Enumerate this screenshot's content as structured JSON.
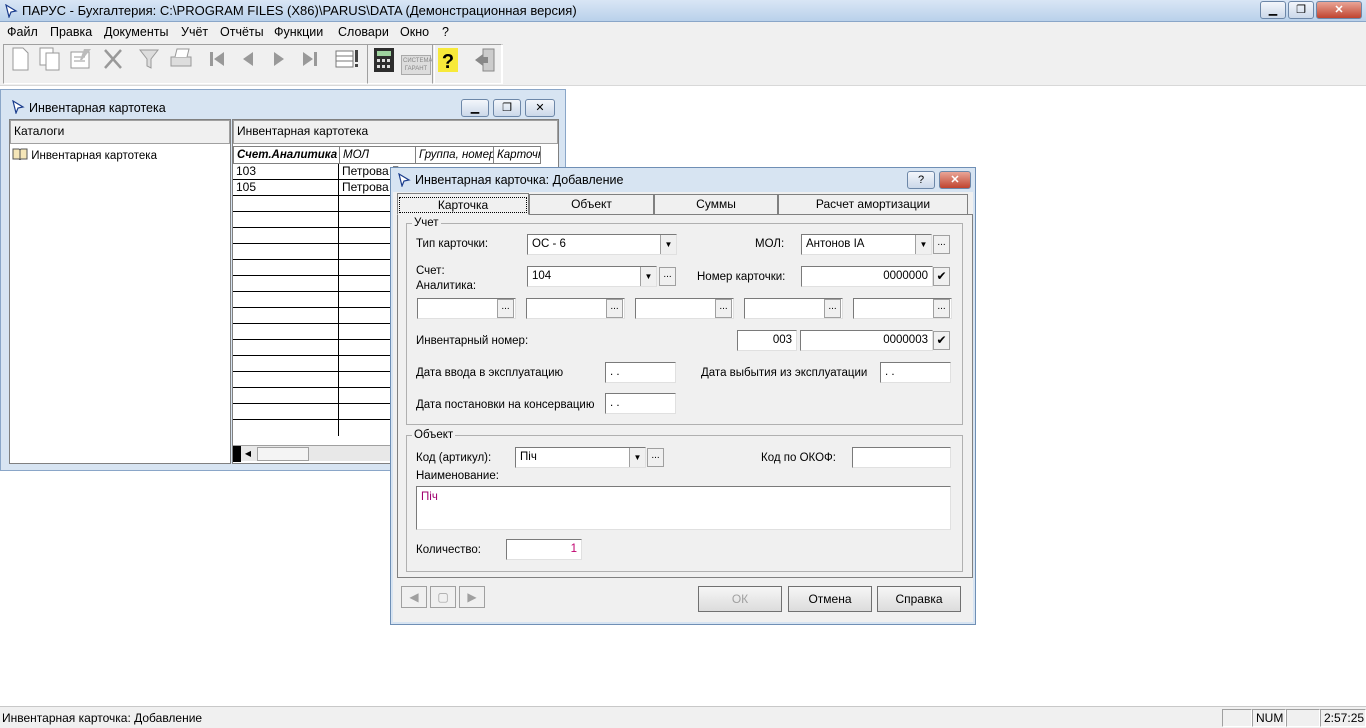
{
  "app": {
    "title": "ПАРУС - Бухгалтерия: C:\\PROGRAM FILES (X86)\\PARUS\\DATA (Демонстрационная версия)",
    "minimize_label": "▁",
    "maximize_label": "❐",
    "close_label": "✕"
  },
  "menu": [
    "Файл",
    "Правка",
    "Документы",
    "Учёт",
    "Отчёты",
    "Функции",
    "Словари",
    "Окно",
    "?"
  ],
  "toolbar": {
    "icons": [
      "new-doc-icon",
      "copy-doc-icon",
      "edit-doc-icon",
      "delete-icon",
      "filter-icon",
      "print-icon",
      "first-record-icon",
      "prev-record-icon",
      "next-record-icon",
      "last-record-icon",
      "list-action-icon",
      "calculator-icon",
      "garant-system-icon",
      "help-icon",
      "exit-icon"
    ],
    "garant_label": "СИСТЕМА ГАРАНТ"
  },
  "child_window": {
    "title": "Инвентарная картотека",
    "catalog_header": "Каталоги",
    "catalog_item": "Инвентарная картотека",
    "list_header": "Инвентарная картотека",
    "columns": [
      "Счет.Аналитика",
      "МОЛ",
      "Группа, номер",
      "Карточка"
    ],
    "rows": [
      {
        "account": "103",
        "mol": "Петрова Г"
      },
      {
        "account": "105",
        "mol": "Петрова Г"
      }
    ]
  },
  "dialog": {
    "title": "Инвентарная карточка: Добавление",
    "help_label": "?",
    "close_label": "✕",
    "tabs": [
      "Карточка",
      "Объект",
      "Суммы",
      "Расчет амортизации"
    ],
    "active_tab": "Карточка",
    "group_account": "Учет",
    "card_type_label": "Тип карточки:",
    "card_type_value": "ОС - 6",
    "mol_label": "МОЛ:",
    "mol_value": "Антонов ІА",
    "account_label": "Счет:",
    "analytics_label": "Аналитика:",
    "account_value": "104",
    "card_number_label": "Номер карточки:",
    "card_number_value": "0000000",
    "inventory_number_label": "Инвентарный номер:",
    "inventory_prefix": "003",
    "inventory_number_value": "0000003",
    "date_commission_label": "Дата ввода в эксплуатацию",
    "date_commission_value": " .  . ",
    "date_retire_label": "Дата выбытия из эксплуатации",
    "date_retire_value": " .  . ",
    "date_conservation_label": "Дата постановки на консервацию",
    "date_conservation_value": " .  . ",
    "group_object": "Объект",
    "code_label": "Код (артикул):",
    "code_value": "Піч",
    "okof_label": "Код по ОКОФ:",
    "okof_value": "",
    "name_label": "Наименование:",
    "name_value": "Піч",
    "quantity_label": "Количество:",
    "quantity_value": "1",
    "ok_label": "ОК",
    "cancel_label": "Отмена",
    "help_button_label": "Справка",
    "ellipsis": "..."
  },
  "status": {
    "text": "Инвентарная карточка: Добавление",
    "num": "NUM",
    "time": "2:57:25"
  }
}
